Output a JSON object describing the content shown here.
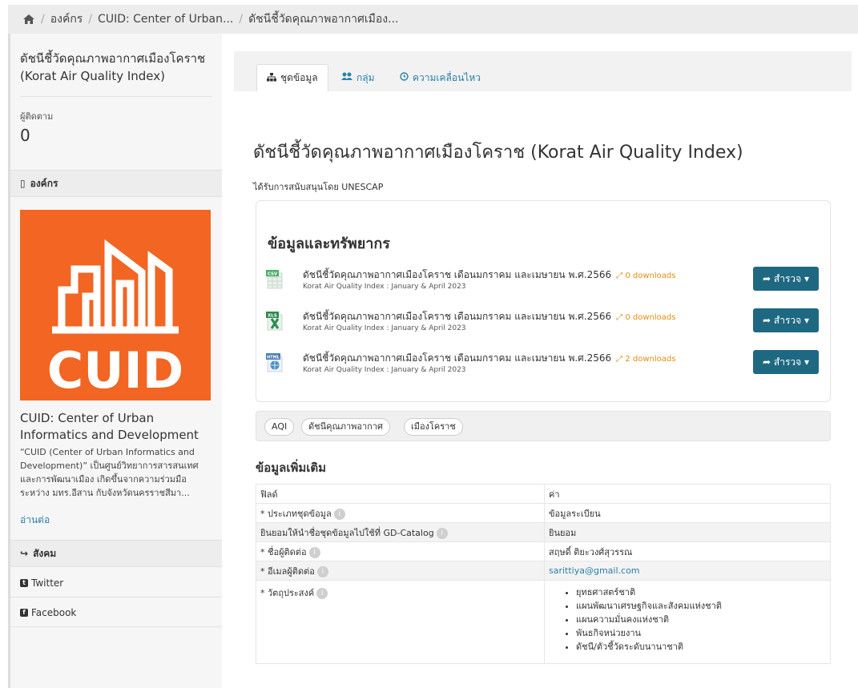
{
  "breadcrumb": {
    "items": [
      "องค์กร",
      "CUID: Center of Urban...",
      "ดัชนีชี้วัดคุณภาพอากาศเมือง..."
    ]
  },
  "sidebar": {
    "title": "ดัชนีชี้วัดคุณภาพอากาศเมืองโคราช (Korat Air Quality Index)",
    "followers_label": "ผู้ติดตาม",
    "followers_count": "0",
    "org_section": "องค์กร",
    "logo_text": "CUID",
    "org_name": "CUID: Center of Urban Informatics and Development",
    "org_desc": "“CUID (Center of Urban Informatics and Development)” เป็นศูนย์วิทยาการสารสนเทศและการพัฒนาเมือง เกิดขึ้นจากความร่วมมือระหว่าง มทร.อีสาน กับจังหวัดนครราชสีมา...",
    "read_more": "อ่านต่อ",
    "social_section": "สังคม",
    "twitter": "Twitter",
    "facebook": "Facebook"
  },
  "tabs": [
    {
      "label": "ชุดข้อมูล",
      "icon": "sitemap-icon"
    },
    {
      "label": "กลุ่ม",
      "icon": "users-icon"
    },
    {
      "label": "ความเคลื่อนไหว",
      "icon": "clock-icon"
    }
  ],
  "dataset": {
    "title": "ดัชนีชี้วัดคุณภาพอากาศเมืองโคราช (Korat Air Quality Index)",
    "sponsor": "ได้รับการสนับสนุนโดย UNESCAP"
  },
  "resources": {
    "heading": "ข้อมูลและทรัพยากร",
    "explore_label": "สำรวจ",
    "items": [
      {
        "format": "CSV",
        "name": "ดัชนีชี้วัดคุณภาพอากาศเมืองโคราช เดือนมกราคม และเมษายน พ.ศ.2566",
        "downloads": "0 downloads",
        "desc": "Korat Air Quality Index : January & April 2023"
      },
      {
        "format": "XLS",
        "name": "ดัชนีชี้วัดคุณภาพอากาศเมืองโคราช เดือนมกราคม และเมษายน พ.ศ.2566",
        "downloads": "0 downloads",
        "desc": "Korat Air Quality Index : January & April 2023"
      },
      {
        "format": "HTML",
        "name": "ดัชนีชี้วัดคุณภาพอากาศเมืองโคราช เดือนมกราคม และเมษายน พ.ศ.2566",
        "downloads": "2 downloads",
        "desc": "Korat Air Quality Index : January & April 2023"
      }
    ]
  },
  "tags": [
    "AQI",
    "ดัชนีคุณภาพอากาศ",
    "เมืองโคราช"
  ],
  "additional": {
    "heading": "ข้อมูลเพิ่มเติม",
    "col_field": "ฟิลด์",
    "col_value": "ค่า",
    "rows": [
      {
        "field": "* ประเภทชุดข้อมูล",
        "value": "ข้อมูลระเบียน"
      },
      {
        "field": "ยินยอมให้นำชื่อชุดข้อมูลไปใช้ที่ GD-Catalog",
        "value": "ยินยอม"
      },
      {
        "field": "* ชื่อผู้ติดต่อ",
        "value": "สฤษดิ์ ติยะวงศ์สุวรรณ"
      },
      {
        "field": "* อีเมลผู้ติดต่อ",
        "value": "sarittiya@gmail.com"
      },
      {
        "field": "* วัตถุประสงค์",
        "value": ""
      }
    ],
    "objectives": [
      "ยุทธศาสตร์ชาติ",
      "แผนพัฒนาเศรษฐกิจและสังคมแห่งชาติ",
      "แผนความมั่นคงแห่งชาติ",
      "พันธกิจหน่วยงาน",
      "ดัชนี/ตัวชี้วัดระดับนานาชาติ"
    ]
  },
  "colors": {
    "brand": "#f26522",
    "button": "#1f6882",
    "link": "#2a7fa8",
    "downloads": "#e38d13"
  }
}
